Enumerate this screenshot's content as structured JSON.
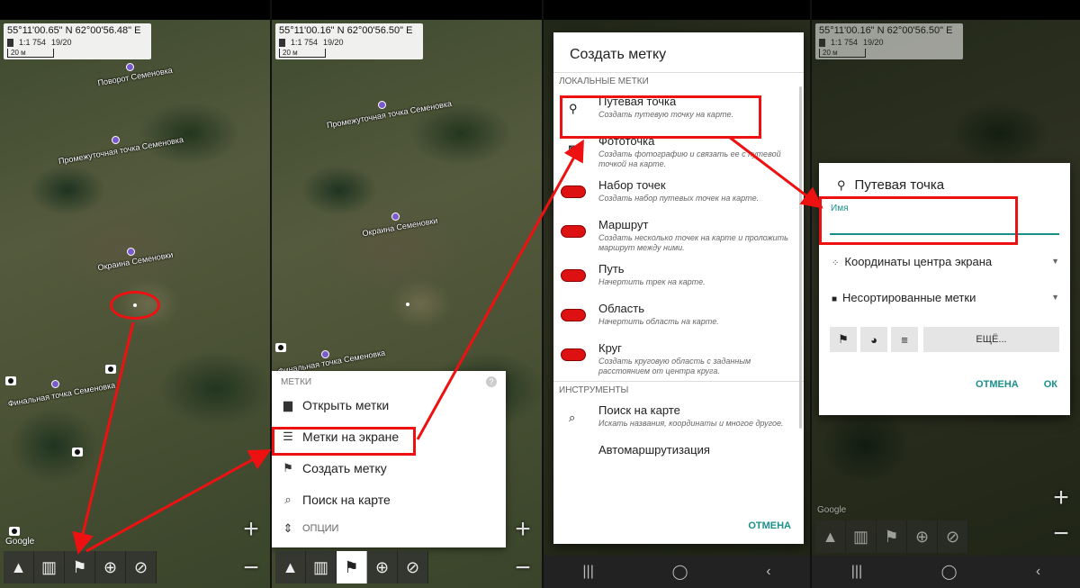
{
  "colors": {
    "highlight": "#e11111",
    "accent": "#1a8f8a"
  },
  "panel1": {
    "coords": "55°11'00.65\" N 62°00'56.48\" E",
    "scale": "1:1 754",
    "zoom": "19/20",
    "scale_bar": "20 м",
    "waypoints": [
      "Поворот Семеновка",
      "Промежуточная точка Семеновка",
      "Окраина Семеновки",
      "Финальная точка Семеновка"
    ],
    "google": "Google"
  },
  "panel2": {
    "coords": "55°11'00.16\" N 62°00'56.50\" E",
    "scale": "1:1 754",
    "zoom": "19/20",
    "scale_bar": "20 м",
    "waypoints": [
      "Промежуточная точка Семеновка",
      "Окраина Семеновки",
      "Финальная точка Семеновка"
    ],
    "menu": {
      "header": "МЕТКИ",
      "help": "?",
      "items": [
        "Открыть метки",
        "Метки на экране",
        "Создать метку",
        "Поиск на карте"
      ],
      "options": "ОПЦИИ"
    }
  },
  "panel3": {
    "title": "Создать метку",
    "section_local": "ЛОКАЛЬНЫЕ МЕТКИ",
    "items": [
      {
        "name": "Путевая точка",
        "desc": "Создать путевую точку на карте.",
        "icon": "waypoint-icon"
      },
      {
        "name": "Фототочка",
        "desc": "Создать фотографию и связать ее с путевой точкой на карте.",
        "icon": "photo-point-icon"
      },
      {
        "name": "Набор точек",
        "desc": "Создать набор путевых точек на карте.",
        "icon": "points-set-icon"
      },
      {
        "name": "Маршрут",
        "desc": "Создать несколько точек на карте и проложить маршрут между ними.",
        "icon": "route-icon"
      },
      {
        "name": "Путь",
        "desc": "Начертить трек на карте.",
        "icon": "track-icon"
      },
      {
        "name": "Область",
        "desc": "Начертить область на карте.",
        "icon": "area-icon"
      },
      {
        "name": "Круг",
        "desc": "Создать круговую область с заданным расстоянием от центра круга.",
        "icon": "circle-icon"
      }
    ],
    "section_tools": "ИНСТРУМЕНТЫ",
    "tool_item": {
      "name": "Поиск на карте",
      "desc": "Искать названия, координаты и многое другое."
    },
    "partial_item": "Автомаршрутизация",
    "cancel": "ОТМЕНА"
  },
  "panel4": {
    "coords": "55°11'00.16\" N 62°00'56.50\" E",
    "scale": "1:1 754",
    "zoom": "19/20",
    "scale_bar": "20 м",
    "dialog": {
      "title": "Путевая точка",
      "name_label": "Имя",
      "coords_select": "Координаты центра экрана",
      "folder_select": "Несортированные метки",
      "more": "ЕЩЁ...",
      "cancel": "ОТМЕНА",
      "ok": "ОК"
    },
    "google": "Google"
  }
}
